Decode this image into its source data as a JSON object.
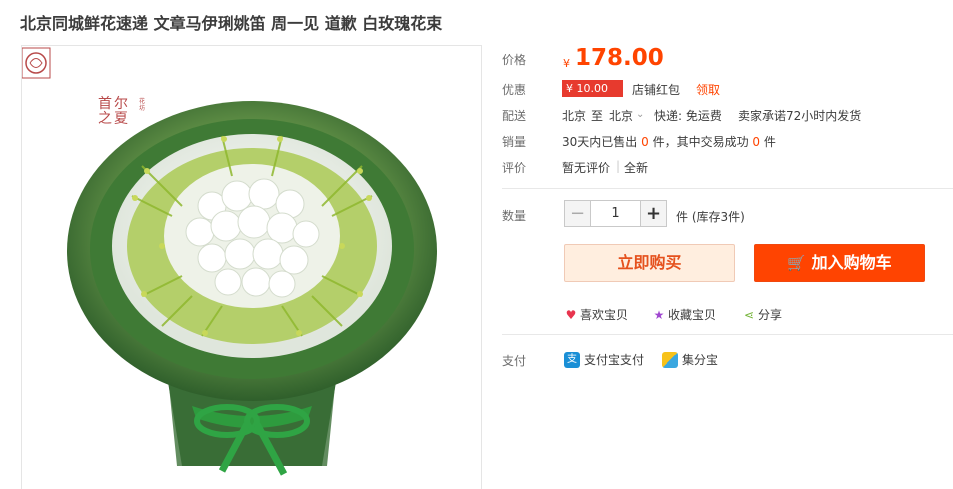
{
  "product": {
    "title": "北京同城鲜花速递 文章马伊琍姚笛 周一见 道歉 白玫瑰花束",
    "brand_logo_text": "首尔之夏",
    "brand_logo_small": "花坊"
  },
  "price": {
    "label": "价格",
    "symbol": "¥",
    "value": "178.00"
  },
  "promo": {
    "label": "优惠",
    "coupon_value": "¥ 10.00",
    "coupon_name": "店铺红包",
    "claim_link": "领取"
  },
  "shipping": {
    "label": "配送",
    "from": "北京",
    "to_word": "至",
    "to": "北京",
    "method": "快递: 免运费",
    "promise": "卖家承诺72小时内发货"
  },
  "sales": {
    "label": "销量",
    "prefix": "30天内已售出",
    "sold": "0",
    "unit1": "件，其中交易成功",
    "success": "0",
    "unit2": "件"
  },
  "review": {
    "label": "评价",
    "none": "暂无评价",
    "new": "全新"
  },
  "quantity": {
    "label": "数量",
    "minus": "−",
    "value": "1",
    "plus": "+",
    "stock": "件 (库存3件)"
  },
  "actions": {
    "buy_now": "立即购买",
    "add_to_cart": "加入购物车"
  },
  "social": {
    "like": "喜欢宝贝",
    "favorite": "收藏宝贝",
    "share": "分享"
  },
  "payment": {
    "label": "支付",
    "alipay": "支付宝支付",
    "jifenbao": "集分宝"
  },
  "colors": {
    "price": "#ff4400",
    "coupon": "#e73a2e",
    "cart": "#ff4401",
    "buy_bg": "#ffeedf"
  }
}
